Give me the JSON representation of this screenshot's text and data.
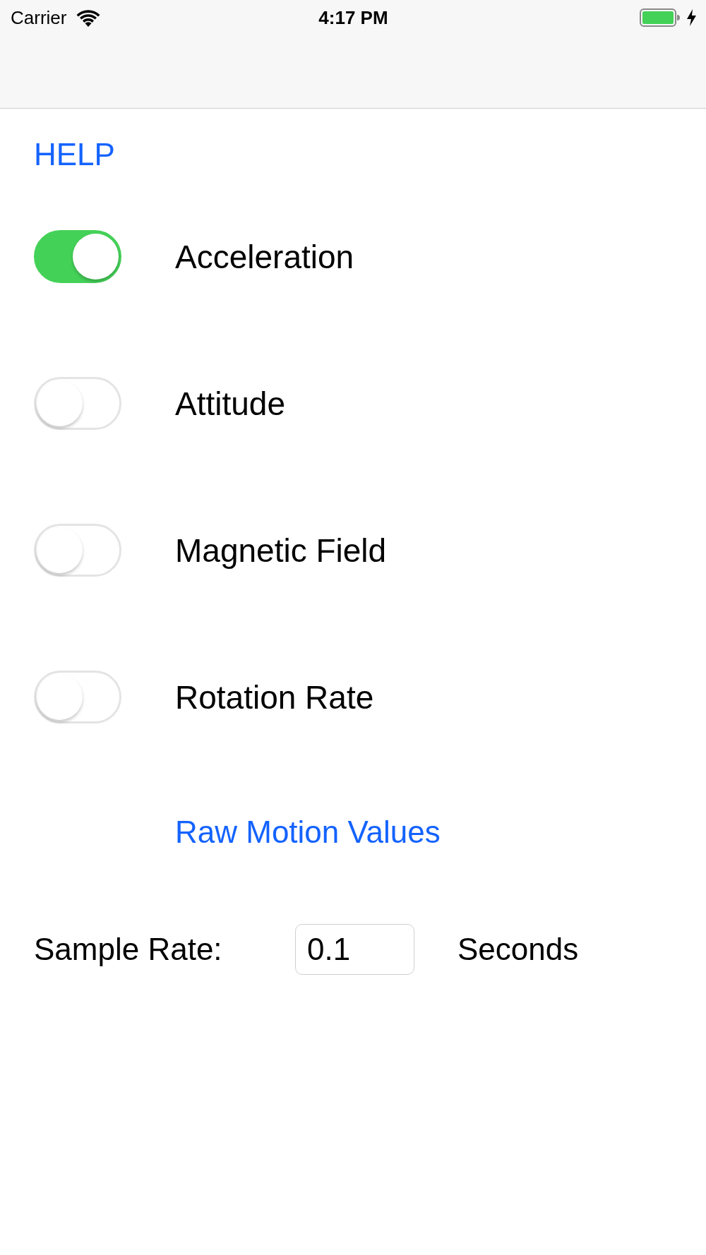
{
  "status_bar": {
    "carrier": "Carrier",
    "time": "4:17 PM"
  },
  "help_link": "HELP",
  "toggles": [
    {
      "label": "Acceleration",
      "on": true
    },
    {
      "label": "Attitude",
      "on": false
    },
    {
      "label": "Magnetic Field",
      "on": false
    },
    {
      "label": "Rotation Rate",
      "on": false
    }
  ],
  "raw_motion_link": "Raw Motion Values",
  "sample_rate": {
    "label": "Sample Rate:",
    "value": "0.1",
    "unit": "Seconds"
  }
}
